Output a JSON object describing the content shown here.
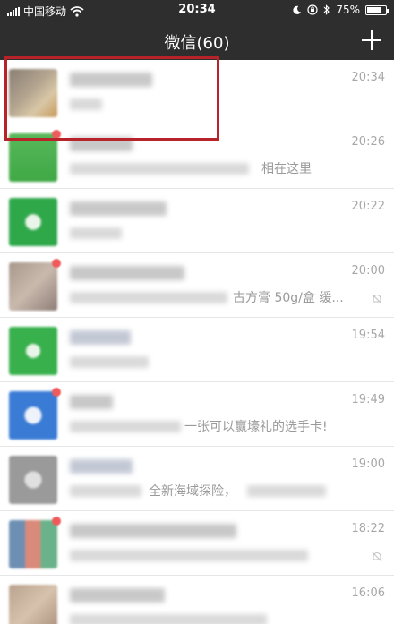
{
  "status_bar": {
    "carrier": "中国移动",
    "time": "20:34",
    "battery": "75%",
    "battery_level": 0.75
  },
  "nav_bar": {
    "title": "微信(60)"
  },
  "chats": [
    {
      "time": "20:34",
      "preview_visible": ""
    },
    {
      "time": "20:26",
      "preview_visible": "相在这里"
    },
    {
      "time": "20:22",
      "preview_visible": ""
    },
    {
      "time": "20:00",
      "preview_visible": "古方膏 50g/盒 缓..."
    },
    {
      "time": "19:54",
      "preview_visible": ""
    },
    {
      "time": "19:49",
      "preview_visible": "一张可以赢壕礼的选手卡!"
    },
    {
      "time": "19:00",
      "preview_visible": "全新海域探险，"
    },
    {
      "time": "18:22",
      "preview_visible": ""
    },
    {
      "time": "16:06",
      "preview_visible": ""
    }
  ],
  "icons": [
    "signal-icon",
    "wifi-icon",
    "moon-icon",
    "lock-rotation-icon",
    "bluetooth-icon",
    "battery-icon",
    "plus-icon",
    "mute-icon"
  ],
  "colors": {
    "bar_bg": "#2e2e2e",
    "highlight": "#b8232a",
    "time_text": "#a7a7a7",
    "badge": "#f05a5a"
  }
}
